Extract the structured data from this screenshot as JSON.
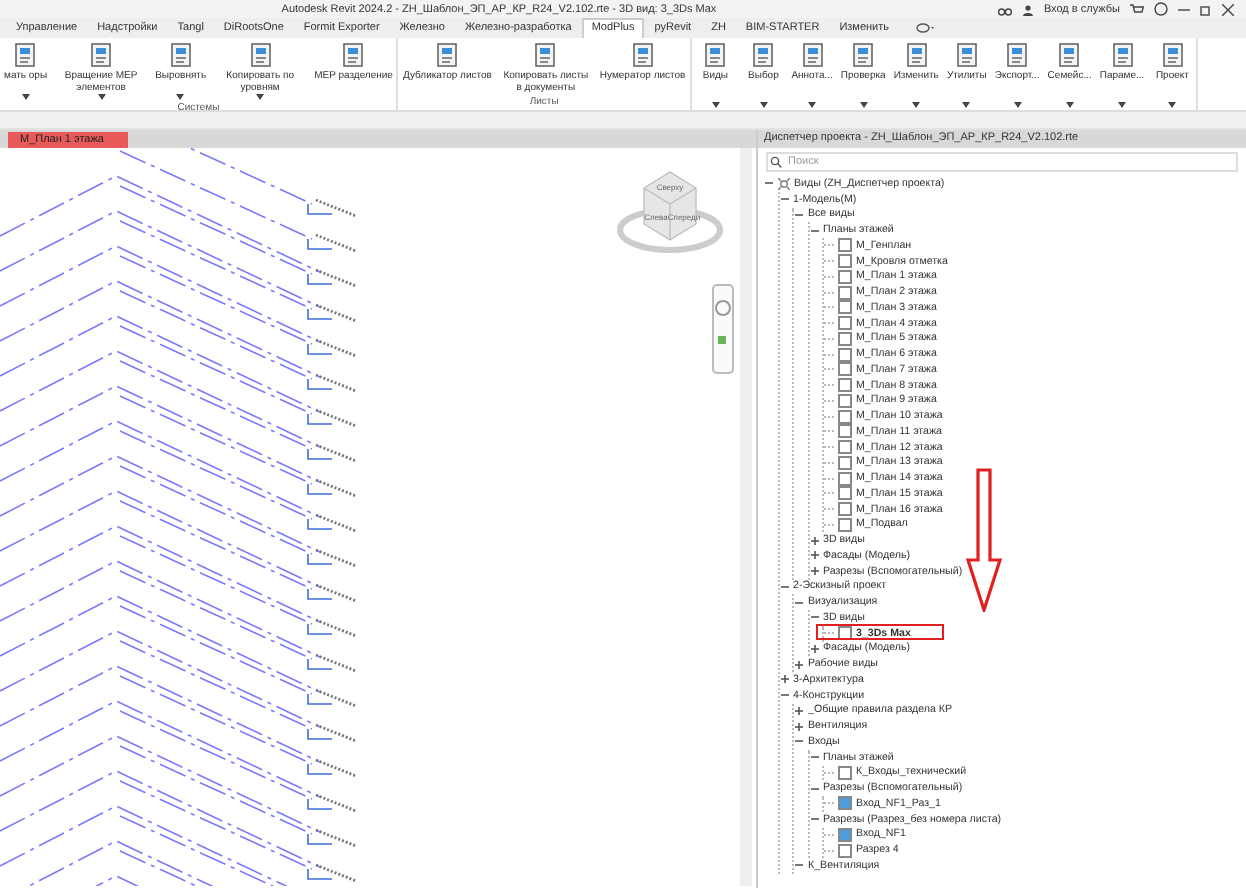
{
  "window": {
    "title": "Autodesk Revit 2024.2 - ZH_Шаблон_ЭП_АР_КР_R24_V2.102.rte - 3D вид: 3_3Ds Max",
    "account": "Вход в службы"
  },
  "ribbon_tabs": [
    {
      "label": "Управление",
      "selected": false
    },
    {
      "label": "Надстройки",
      "selected": false
    },
    {
      "label": "Tangl",
      "selected": false
    },
    {
      "label": "DiRootsOne",
      "selected": false
    },
    {
      "label": "Formit Exporter",
      "selected": false
    },
    {
      "label": "Железно",
      "selected": false
    },
    {
      "label": "Железно-разработка",
      "selected": false
    },
    {
      "label": "ModPlus",
      "selected": true
    },
    {
      "label": "pyRevit",
      "selected": false
    },
    {
      "label": "ZH",
      "selected": false
    },
    {
      "label": "BIM-STARTER",
      "selected": false
    },
    {
      "label": "Изменить",
      "selected": false
    }
  ],
  "ribbon_groups": [
    {
      "title": "Системы",
      "buttons": [
        {
          "label": "мать оры",
          "dropdown": true
        },
        {
          "label": "Вращение MEP элементов",
          "dropdown": true
        },
        {
          "label": "Выровнять",
          "dropdown": true
        },
        {
          "label": "Копировать по уровням",
          "dropdown": true
        },
        {
          "label": "MEP разделение",
          "dropdown": false
        }
      ]
    },
    {
      "title": "Листы",
      "buttons": [
        {
          "label": "Дубликатор листов",
          "dropdown": false
        },
        {
          "label": "Копировать листы в документы",
          "dropdown": false
        },
        {
          "label": "Нумератор листов",
          "dropdown": false
        }
      ]
    },
    {
      "buttons": [
        {
          "label": "Виды",
          "dropdown": true
        },
        {
          "label": "Выбор",
          "dropdown": true
        },
        {
          "label": "Аннота...",
          "dropdown": true
        },
        {
          "label": "Проверка",
          "dropdown": true
        },
        {
          "label": "Изменить",
          "dropdown": true
        },
        {
          "label": "Утилиты",
          "dropdown": true
        },
        {
          "label": "Экспорт...",
          "dropdown": true
        },
        {
          "label": "Семейс...",
          "dropdown": true
        },
        {
          "label": "Параме...",
          "dropdown": true
        },
        {
          "label": "Проект",
          "dropdown": true
        }
      ]
    }
  ],
  "view_tab": {
    "label": "M_План 1 этажа"
  },
  "viewcube": {
    "top": "Сверху",
    "left": "Слева",
    "front": "Спереди"
  },
  "project_browser": {
    "title": "Диспетчер проекта - ZH_Шаблон_ЭП_АР_КР_R24_V2.102.rte",
    "search": {
      "placeholder": "Поиск"
    },
    "tree": [
      {
        "kind": "root",
        "label": "Виды (ZH_Диспетчер проекта)",
        "expanded": true,
        "children": [
          {
            "kind": "group",
            "label": "1-Модель(М)",
            "expanded": true,
            "children": [
              {
                "kind": "group",
                "label": "Все виды",
                "expanded": true,
                "children": [
                  {
                    "kind": "group",
                    "label": "Планы этажей",
                    "expanded": true,
                    "children": [
                      {
                        "kind": "view",
                        "label": "M_Генплан",
                        "placed": false,
                        "selected": false
                      },
                      {
                        "kind": "view",
                        "label": "M_Кровля отметка",
                        "placed": false,
                        "selected": false
                      },
                      {
                        "kind": "view",
                        "label": "M_План 1 этажа",
                        "placed": false,
                        "selected": false
                      },
                      {
                        "kind": "view",
                        "label": "M_План 2 этажа",
                        "placed": false,
                        "selected": false
                      },
                      {
                        "kind": "view",
                        "label": "M_План 3 этажа",
                        "placed": false,
                        "selected": false
                      },
                      {
                        "kind": "view",
                        "label": "M_План 4 этажа",
                        "placed": false,
                        "selected": false
                      },
                      {
                        "kind": "view",
                        "label": "M_План 5 этажа",
                        "placed": false,
                        "selected": false
                      },
                      {
                        "kind": "view",
                        "label": "M_План 6 этажа",
                        "placed": false,
                        "selected": false
                      },
                      {
                        "kind": "view",
                        "label": "M_План 7 этажа",
                        "placed": false,
                        "selected": false
                      },
                      {
                        "kind": "view",
                        "label": "M_План 8 этажа",
                        "placed": false,
                        "selected": false
                      },
                      {
                        "kind": "view",
                        "label": "M_План 9 этажа",
                        "placed": false,
                        "selected": false
                      },
                      {
                        "kind": "view",
                        "label": "M_План 10 этажа",
                        "placed": false,
                        "selected": false
                      },
                      {
                        "kind": "view",
                        "label": "M_План 11 этажа",
                        "placed": false,
                        "selected": false
                      },
                      {
                        "kind": "view",
                        "label": "M_План 12 этажа",
                        "placed": false,
                        "selected": false
                      },
                      {
                        "kind": "view",
                        "label": "M_План 13 этажа",
                        "placed": false,
                        "selected": false
                      },
                      {
                        "kind": "view",
                        "label": "M_План 14 этажа",
                        "placed": false,
                        "selected": false
                      },
                      {
                        "kind": "view",
                        "label": "M_План 15 этажа",
                        "placed": false,
                        "selected": false
                      },
                      {
                        "kind": "view",
                        "label": "M_План 16 этажа",
                        "placed": false,
                        "selected": false
                      },
                      {
                        "kind": "view",
                        "label": "M_Подвал",
                        "placed": false,
                        "selected": false
                      }
                    ]
                  },
                  {
                    "kind": "group",
                    "label": "3D виды",
                    "expanded": false
                  },
                  {
                    "kind": "group",
                    "label": "Фасады (Модель)",
                    "expanded": false
                  },
                  {
                    "kind": "group",
                    "label": "Разрезы (Вспомогательный)",
                    "expanded": false
                  }
                ]
              }
            ]
          },
          {
            "kind": "group",
            "label": "2-Эскизный проект",
            "expanded": true,
            "children": [
              {
                "kind": "group",
                "label": "Визуализация",
                "expanded": true,
                "children": [
                  {
                    "kind": "group",
                    "label": "3D виды",
                    "expanded": true,
                    "children": [
                      {
                        "kind": "view",
                        "label": "3_3Ds Max",
                        "placed": false,
                        "selected": true
                      }
                    ]
                  },
                  {
                    "kind": "group",
                    "label": "Фасады (Модель)",
                    "expanded": false
                  }
                ]
              },
              {
                "kind": "group",
                "label": "Рабочие виды",
                "expanded": false
              }
            ]
          },
          {
            "kind": "group",
            "label": "3-Архитектура",
            "expanded": false
          },
          {
            "kind": "group",
            "label": "4-Конструкции",
            "expanded": true,
            "children": [
              {
                "kind": "group",
                "label": "_Общие правила раздела КР",
                "expanded": false
              },
              {
                "kind": "group",
                "label": "Вентиляция",
                "expanded": false
              },
              {
                "kind": "group",
                "label": "Входы",
                "expanded": true,
                "children": [
                  {
                    "kind": "group",
                    "label": "Планы этажей",
                    "expanded": true,
                    "children": [
                      {
                        "kind": "view",
                        "label": "К_Входы_технический",
                        "placed": false,
                        "selected": false
                      }
                    ]
                  },
                  {
                    "kind": "group",
                    "label": "Разрезы (Вспомогательный)",
                    "expanded": true,
                    "children": [
                      {
                        "kind": "view",
                        "label": "Вход_NF1_Раз_1",
                        "placed": true,
                        "selected": false
                      }
                    ]
                  },
                  {
                    "kind": "group",
                    "label": "Разрезы (Разрез_без номера листа)",
                    "expanded": true,
                    "children": [
                      {
                        "kind": "view",
                        "label": "Вход_NF1",
                        "placed": true,
                        "selected": false
                      },
                      {
                        "kind": "view",
                        "label": "Разрез 4",
                        "placed": false,
                        "selected": false
                      }
                    ]
                  }
                ]
              },
              {
                "kind": "group",
                "label": "К_Вентиляция",
                "expanded": true
              }
            ]
          }
        ]
      }
    ]
  }
}
